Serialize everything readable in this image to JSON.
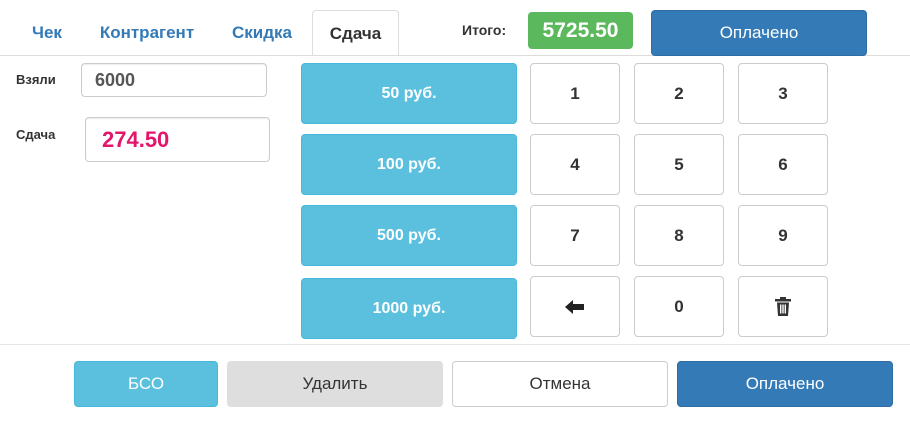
{
  "tabs": [
    {
      "label": "Чек",
      "active": false
    },
    {
      "label": "Контрагент",
      "active": false
    },
    {
      "label": "Скидка",
      "active": false
    },
    {
      "label": "Сдача",
      "active": true
    }
  ],
  "total": {
    "label": "Итого:",
    "value": "5725.50"
  },
  "top_paid_label": "Оплачено",
  "taken": {
    "label": "Взяли",
    "value": "6000"
  },
  "change": {
    "label": "Сдача",
    "value": "274.50"
  },
  "money_buttons": [
    "50 руб.",
    "100 руб.",
    "500 руб.",
    "1000 руб."
  ],
  "keypad": [
    "1",
    "2",
    "3",
    "4",
    "5",
    "6",
    "7",
    "8",
    "9",
    "backspace-icon",
    "0",
    "trash-icon"
  ],
  "footer": {
    "bso": "БСО",
    "delete": "Удалить",
    "cancel": "Отмена",
    "paid": "Оплачено"
  },
  "colors": {
    "accent": "#337ab7",
    "info": "#5bc0de",
    "success": "#5cb85c",
    "change_text": "#e2176c"
  }
}
